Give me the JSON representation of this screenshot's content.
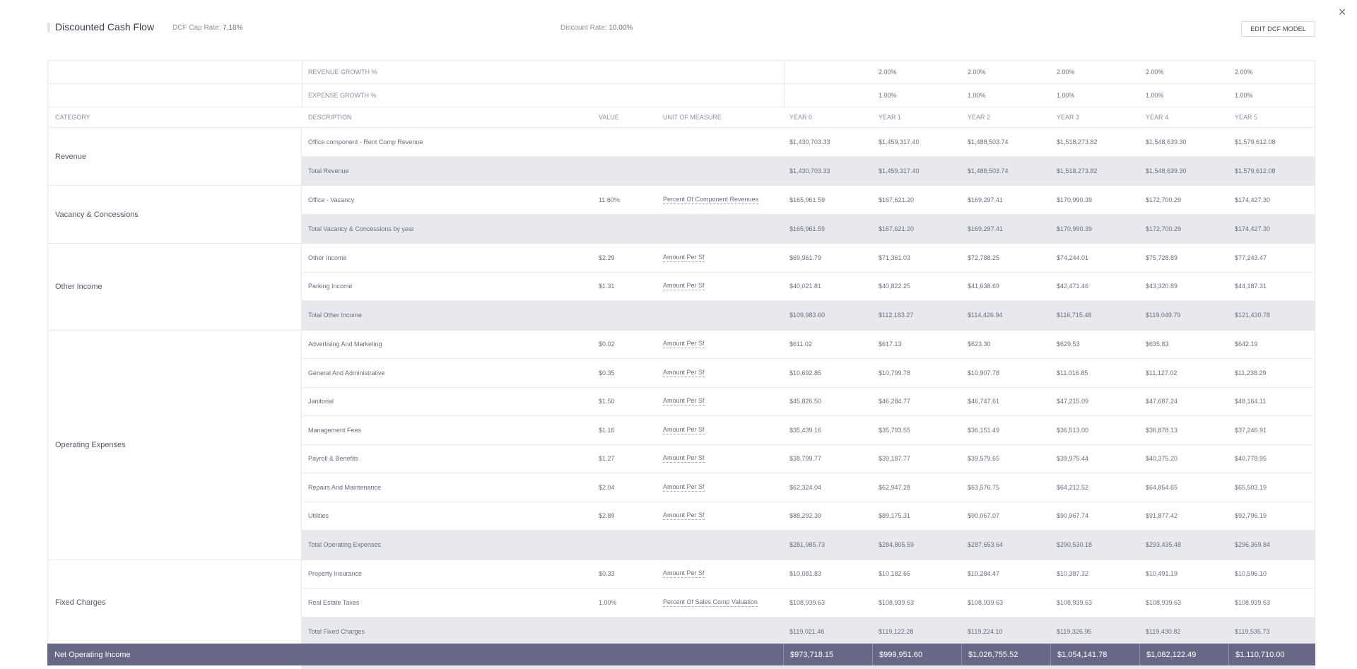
{
  "header": {
    "title": "Discounted Cash Flow",
    "cap_rate_label": "DCF Cap Rate:",
    "cap_rate_value": "7.18%",
    "discount_label": "Discount Rate:",
    "discount_value": "10.00%",
    "edit_button": "EDIT DCF MODEL",
    "close_icon": "×"
  },
  "growth": [
    {
      "label": "REVENUE GROWTH %",
      "values": [
        "2.00%",
        "2.00%",
        "2.00%",
        "2.00%",
        "2.00%"
      ]
    },
    {
      "label": "EXPENSE GROWTH %",
      "values": [
        "1.00%",
        "1.00%",
        "1.00%",
        "1.00%",
        "1.00%"
      ]
    }
  ],
  "columns": {
    "category": "CATEGORY",
    "description": "DESCRIPTION",
    "value": "VALUE",
    "unit": "UNIT OF MEASURE",
    "years": [
      "YEAR 0",
      "YEAR 1",
      "YEAR 2",
      "YEAR 3",
      "YEAR 4",
      "YEAR 5"
    ]
  },
  "groups": [
    {
      "category": "Revenue",
      "rows": [
        {
          "desc": "Office component - Rent Comp Revenue",
          "value": "",
          "unit": "",
          "years": [
            "$1,430,703.33",
            "$1,459,317.40",
            "$1,488,503.74",
            "$1,518,273.82",
            "$1,548,639.30",
            "$1,579,612.08"
          ]
        },
        {
          "desc": "Total Revenue",
          "value": "",
          "unit": "",
          "total": true,
          "years": [
            "$1,430,703.33",
            "$1,459,317.40",
            "$1,488,503.74",
            "$1,518,273.82",
            "$1,548,639.30",
            "$1,579,612.08"
          ]
        }
      ]
    },
    {
      "category": "Vacancy & Concessions",
      "rows": [
        {
          "desc": "Office - Vacancy",
          "value": "11.60%",
          "unit": "Percent Of Component Revenues",
          "years": [
            "$165,961.59",
            "$167,621.20",
            "$169,297.41",
            "$170,990.39",
            "$172,700.29",
            "$174,427.30"
          ]
        },
        {
          "desc": "Total Vacancy & Concessions by year",
          "value": "",
          "unit": "",
          "total": true,
          "years": [
            "$165,961.59",
            "$167,621.20",
            "$169,297.41",
            "$170,990.39",
            "$172,700.29",
            "$174,427.30"
          ]
        }
      ]
    },
    {
      "category": "Other Income",
      "rows": [
        {
          "desc": "Other Income",
          "value": "$2.29",
          "unit": "Amount Per Sf",
          "years": [
            "$69,961.79",
            "$71,361.03",
            "$72,788.25",
            "$74,244.01",
            "$75,728.89",
            "$77,243.47"
          ]
        },
        {
          "desc": "Parking Income",
          "value": "$1.31",
          "unit": "Amount Per Sf",
          "years": [
            "$40,021.81",
            "$40,822.25",
            "$41,638.69",
            "$42,471.46",
            "$43,320.89",
            "$44,187.31"
          ]
        },
        {
          "desc": "Total Other Income",
          "value": "",
          "unit": "",
          "total": true,
          "years": [
            "$109,983.60",
            "$112,183.27",
            "$114,426.94",
            "$116,715.48",
            "$119,049.79",
            "$121,430.78"
          ]
        }
      ]
    },
    {
      "category": "Operating Expenses",
      "rows": [
        {
          "desc": "Advertising And Marketing",
          "value": "$0.02",
          "unit": "Amount Per Sf",
          "years": [
            "$611.02",
            "$617.13",
            "$623.30",
            "$629.53",
            "$635.83",
            "$642.19"
          ]
        },
        {
          "desc": "General And Administrative",
          "value": "$0.35",
          "unit": "Amount Per Sf",
          "years": [
            "$10,692.85",
            "$10,799.78",
            "$10,907.78",
            "$11,016.85",
            "$11,127.02",
            "$11,238.29"
          ]
        },
        {
          "desc": "Janitorial",
          "value": "$1.50",
          "unit": "Amount Per Sf",
          "years": [
            "$45,826.50",
            "$46,284.77",
            "$46,747.61",
            "$47,215.09",
            "$47,687.24",
            "$48,164.11"
          ]
        },
        {
          "desc": "Management Fees",
          "value": "$1.16",
          "unit": "Amount Per Sf",
          "years": [
            "$35,439.16",
            "$35,793.55",
            "$36,151.49",
            "$36,513.00",
            "$36,878.13",
            "$37,246.91"
          ]
        },
        {
          "desc": "Payroll & Benefits",
          "value": "$1.27",
          "unit": "Amount Per Sf",
          "years": [
            "$38,799.77",
            "$39,187.77",
            "$39,579.65",
            "$39,975.44",
            "$40,375.20",
            "$40,778.95"
          ]
        },
        {
          "desc": "Repairs And Maintenance",
          "value": "$2.04",
          "unit": "Amount Per Sf",
          "years": [
            "$62,324.04",
            "$62,947.28",
            "$63,576.75",
            "$64,212.52",
            "$64,854.65",
            "$65,503.19"
          ]
        },
        {
          "desc": "Utilities",
          "value": "$2.89",
          "unit": "Amount Per Sf",
          "years": [
            "$88,292.39",
            "$89,175.31",
            "$90,067.07",
            "$90,967.74",
            "$91,877.42",
            "$92,796.19"
          ]
        },
        {
          "desc": "Total Operating Expenses",
          "value": "",
          "unit": "",
          "total": true,
          "years": [
            "$281,985.73",
            "$284,805.59",
            "$287,653.64",
            "$290,530.18",
            "$293,435.48",
            "$296,369.84"
          ]
        }
      ]
    },
    {
      "category": "Fixed Charges",
      "rows": [
        {
          "desc": "Property Insurance",
          "value": "$0.33",
          "unit": "Amount Per Sf",
          "years": [
            "$10,081.83",
            "$10,182.65",
            "$10,284.47",
            "$10,387.32",
            "$10,491.19",
            "$10,596.10"
          ]
        },
        {
          "desc": "Real Estate Taxes",
          "value": "1.00%",
          "unit": "Percent Of Sales Comp Valuation",
          "years": [
            "$108,939.63",
            "$108,939.63",
            "$108,939.63",
            "$108,939.63",
            "$108,939.63",
            "$108,939.63"
          ]
        },
        {
          "desc": "Total Fixed Charges",
          "value": "",
          "unit": "",
          "total": true,
          "years": [
            "$119,021.46",
            "$119,122.28",
            "$119,224.10",
            "$119,326.95",
            "$119,430.82",
            "$119,535.73"
          ]
        }
      ]
    }
  ],
  "noi": {
    "label": "Net Operating Income",
    "years": [
      "$973,718.15",
      "$999,951.60",
      "$1,026,755.52",
      "$1,054,141.78",
      "$1,082,122.49",
      "$1,110,710.00"
    ]
  },
  "colors": {
    "noi_background": "#676886",
    "total_row_background": "#e8e9ed",
    "text": "#6b6f80"
  }
}
